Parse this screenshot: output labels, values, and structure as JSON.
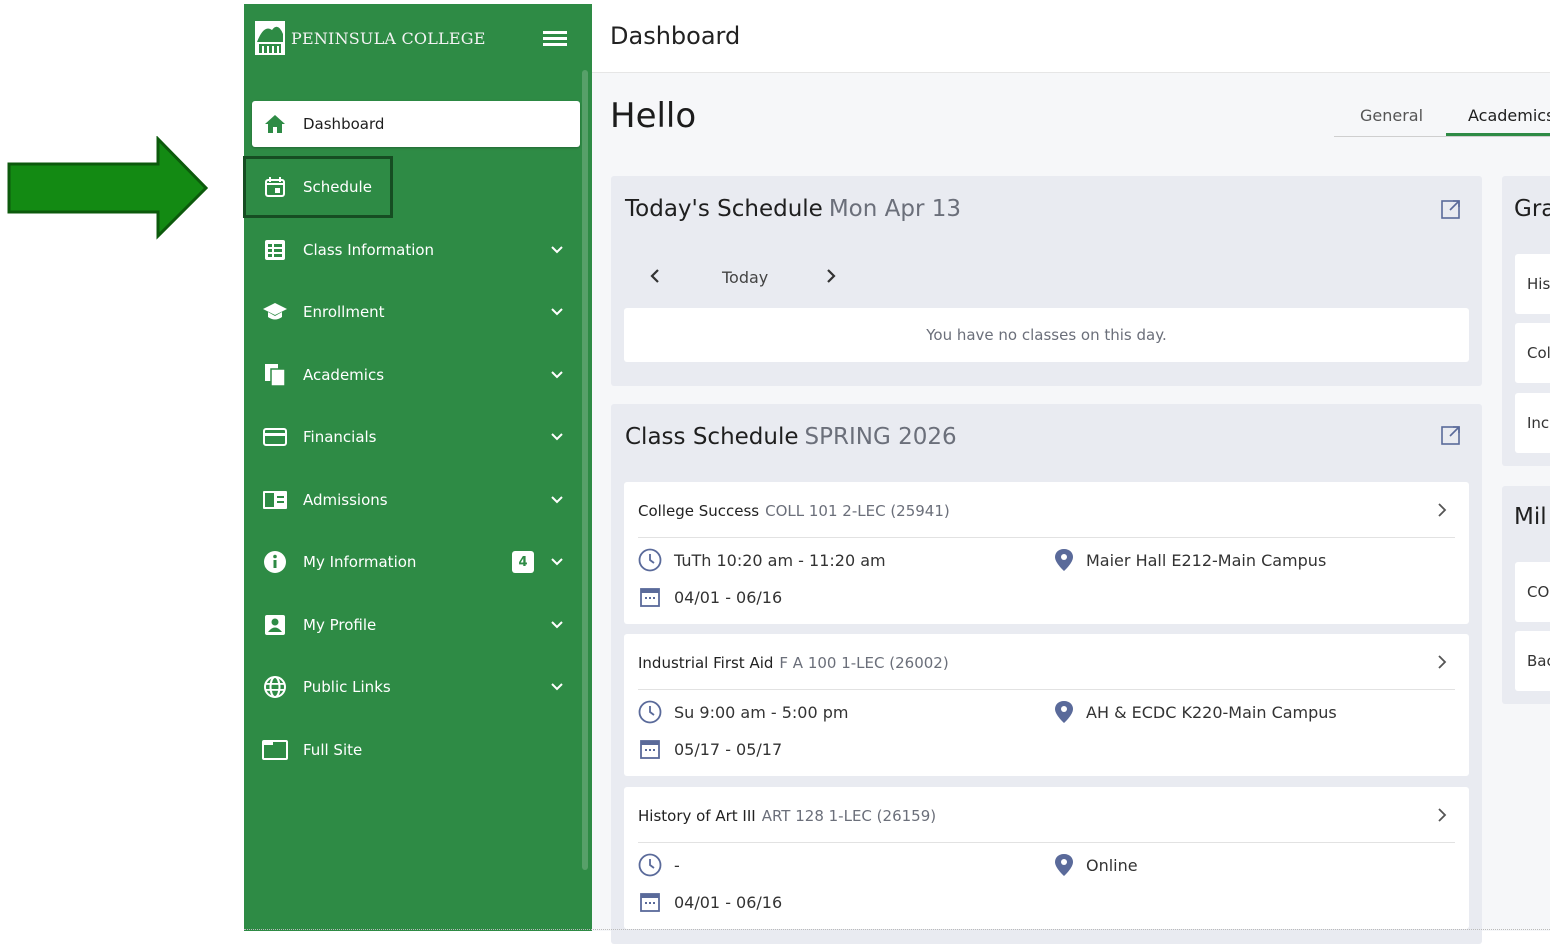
{
  "sidebar": {
    "brand": "PENINSULA COLLEGE",
    "items": [
      {
        "label": "Dashboard",
        "icon": "home-icon"
      },
      {
        "label": "Schedule",
        "icon": "calendar-icon"
      },
      {
        "label": "Class Information",
        "icon": "list-icon"
      },
      {
        "label": "Enrollment",
        "icon": "graduation-cap-icon"
      },
      {
        "label": "Academics",
        "icon": "documents-icon"
      },
      {
        "label": "Financials",
        "icon": "credit-card-icon"
      },
      {
        "label": "Admissions",
        "icon": "id-card-icon"
      },
      {
        "label": "My Information",
        "icon": "info-icon",
        "badge": "4"
      },
      {
        "label": "My Profile",
        "icon": "user-icon"
      },
      {
        "label": "Public Links",
        "icon": "globe-icon"
      },
      {
        "label": "Full Site",
        "icon": "window-icon"
      }
    ]
  },
  "header": {
    "title": "Dashboard"
  },
  "greeting": "Hello",
  "tabs": [
    "General",
    "Academics"
  ],
  "today": {
    "title": "Today's Schedule",
    "date": "Mon Apr 13",
    "nav_label": "Today",
    "empty": "You have no classes on this day."
  },
  "class_schedule": {
    "title": "Class Schedule",
    "term": "SPRING 2026",
    "classes": [
      {
        "name": "College Success",
        "code": "COLL 101 2-LEC (25941)",
        "time": "TuTh 10:20 am - 11:20 am",
        "location": "Maier Hall E212-Main Campus",
        "dates": "04/01 - 06/16"
      },
      {
        "name": "Industrial First Aid",
        "code": "F A 100 1-LEC (26002)",
        "time": "Su 9:00 am - 5:00 pm",
        "location": "AH & ECDC K220-Main Campus",
        "dates": "05/17 - 05/17"
      },
      {
        "name": "History of Art III",
        "code": "ART 128 1-LEC (26159)",
        "time": "-",
        "location": "Online",
        "dates": "04/01 - 06/16"
      }
    ]
  },
  "right_panel": {
    "card1_title": "Gra",
    "card1_items": [
      "His",
      "Col",
      "Inc"
    ],
    "card2_title": "Mil",
    "card2_items": [
      "CO",
      "Bac"
    ]
  },
  "colors": {
    "sidebar_green": "#2e8b45",
    "arrow_green": "#1a8a1a",
    "highlight_border": "#164d22"
  }
}
